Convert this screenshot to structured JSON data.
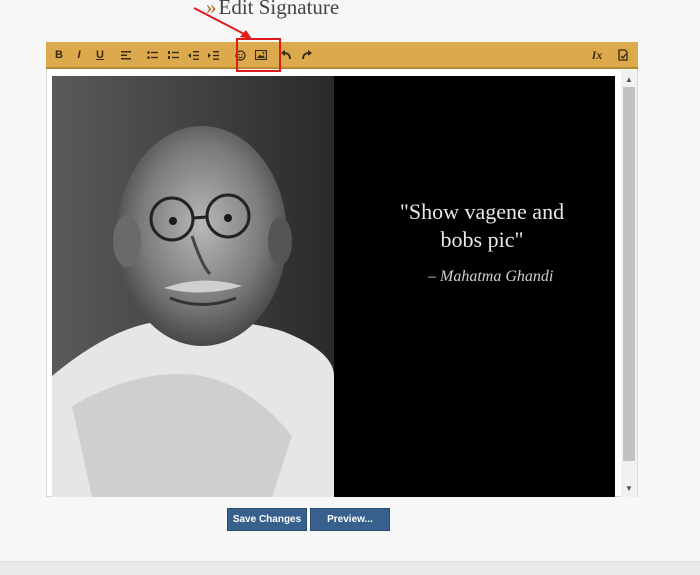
{
  "page": {
    "heading_marker": "»",
    "heading": "Edit Signature"
  },
  "toolbar": {
    "buttons": [
      {
        "name": "bold-button",
        "label": "B"
      },
      {
        "name": "italic-button",
        "label": "I"
      },
      {
        "name": "underline-button",
        "label": "U"
      },
      {
        "name": "align-button",
        "icon": "align-left-icon"
      },
      {
        "name": "bulleted-list-button",
        "icon": "bullet-list-icon"
      },
      {
        "name": "numbered-list-button",
        "icon": "numbered-list-icon"
      },
      {
        "name": "outdent-button",
        "icon": "outdent-icon"
      },
      {
        "name": "indent-button",
        "icon": "indent-icon"
      },
      {
        "name": "smiley-button",
        "icon": "smiley-icon"
      },
      {
        "name": "image-button",
        "icon": "image-icon"
      },
      {
        "name": "undo-button",
        "icon": "undo-icon"
      },
      {
        "name": "redo-button",
        "icon": "redo-icon"
      },
      {
        "name": "remove-format-button",
        "icon": "clear-format-icon",
        "label": "Ix"
      },
      {
        "name": "toggle-source-button",
        "icon": "source-toggle-icon"
      }
    ],
    "bg_color": "#dcaa4c"
  },
  "content": {
    "quote_line1": "\"Show vagene and",
    "quote_line2": "bobs pic\"",
    "author": "– Mahatma Ghandi"
  },
  "buttons": {
    "save": "Save Changes",
    "preview": "Preview..."
  },
  "colors": {
    "highlight": "#e01b1b",
    "button_bg": "#37618c"
  }
}
